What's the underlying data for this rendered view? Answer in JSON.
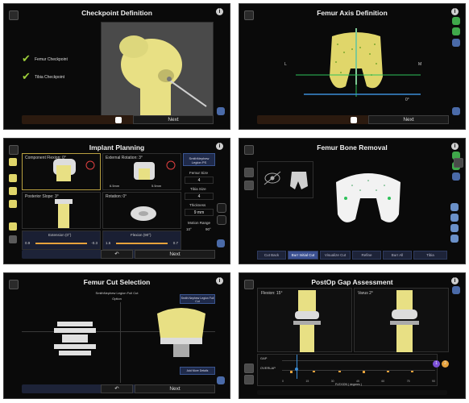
{
  "panels": {
    "checkpoint": {
      "title": "Checkpoint Definition",
      "femur_label": "Femur Checkpoint",
      "tibia_label": "Tibia Checkpoint",
      "next": "Next"
    },
    "femur_axis": {
      "title": "Femur Axis Definition",
      "L": "L",
      "M": "M",
      "angle": "0°",
      "next": "Next"
    },
    "implant": {
      "title": "Implant Planning",
      "component_flexion": "Component Flexion: 0°",
      "external_rotation": "External Rotation: 3°",
      "posterior_slope": "Posterior Slope: 3°",
      "rotation": "Rotation: 0°",
      "extension_label": "Extension (0°)",
      "flexion_label": "Flexion (90°)",
      "ext_left": "0.9",
      "ext_right": "-0.3",
      "flex_left": "1.6",
      "flex_right": "0.7",
      "device_name": "SmithNephew Legion PS",
      "femur_size_label": "Femur Size",
      "femur_size": "4",
      "tibia_size_label": "Tibia Size",
      "tibia_size": "4",
      "thickness_label": "Thickness",
      "thickness": "9 mm",
      "motion_label": "Motion Range",
      "motion_min": "10°",
      "motion_max": "90°",
      "gap_e1": "6.5mm",
      "gap_e2": "5.5mm",
      "next": "Next"
    },
    "bone_removal": {
      "title": "Femur Bone Removal",
      "tabs": [
        "Cut Back",
        "Burr Initial Cut",
        "Visualize Cut",
        "Refine",
        "Burr All",
        "Tibia"
      ]
    },
    "cut_selection": {
      "title": "Femur Cut Selection",
      "sub1": "SmithNephew Legion Full Cut",
      "option": "Option",
      "btn_implant": "Smith Nephew Legion Full Cut",
      "btn_add": "Add More Details",
      "next": "Next"
    },
    "gap": {
      "title": "PostOp Gap Assessment",
      "flexion": "Flexion: 15°",
      "varus": "Varus 2°",
      "axis_label": "FLEXION ( degrees )",
      "row1": "GAP",
      "row2": "OVERLAP",
      "ticks": [
        "0",
        "15",
        "30",
        "45",
        "60",
        "75",
        "90"
      ],
      "btn1": "1",
      "btn2": "2"
    }
  },
  "colors": {
    "bone": "#e8e084",
    "blue_accent": "#3a5590",
    "green": "#9ccc3a",
    "orange": "#e6a23c",
    "purple": "#7b4fd6"
  }
}
